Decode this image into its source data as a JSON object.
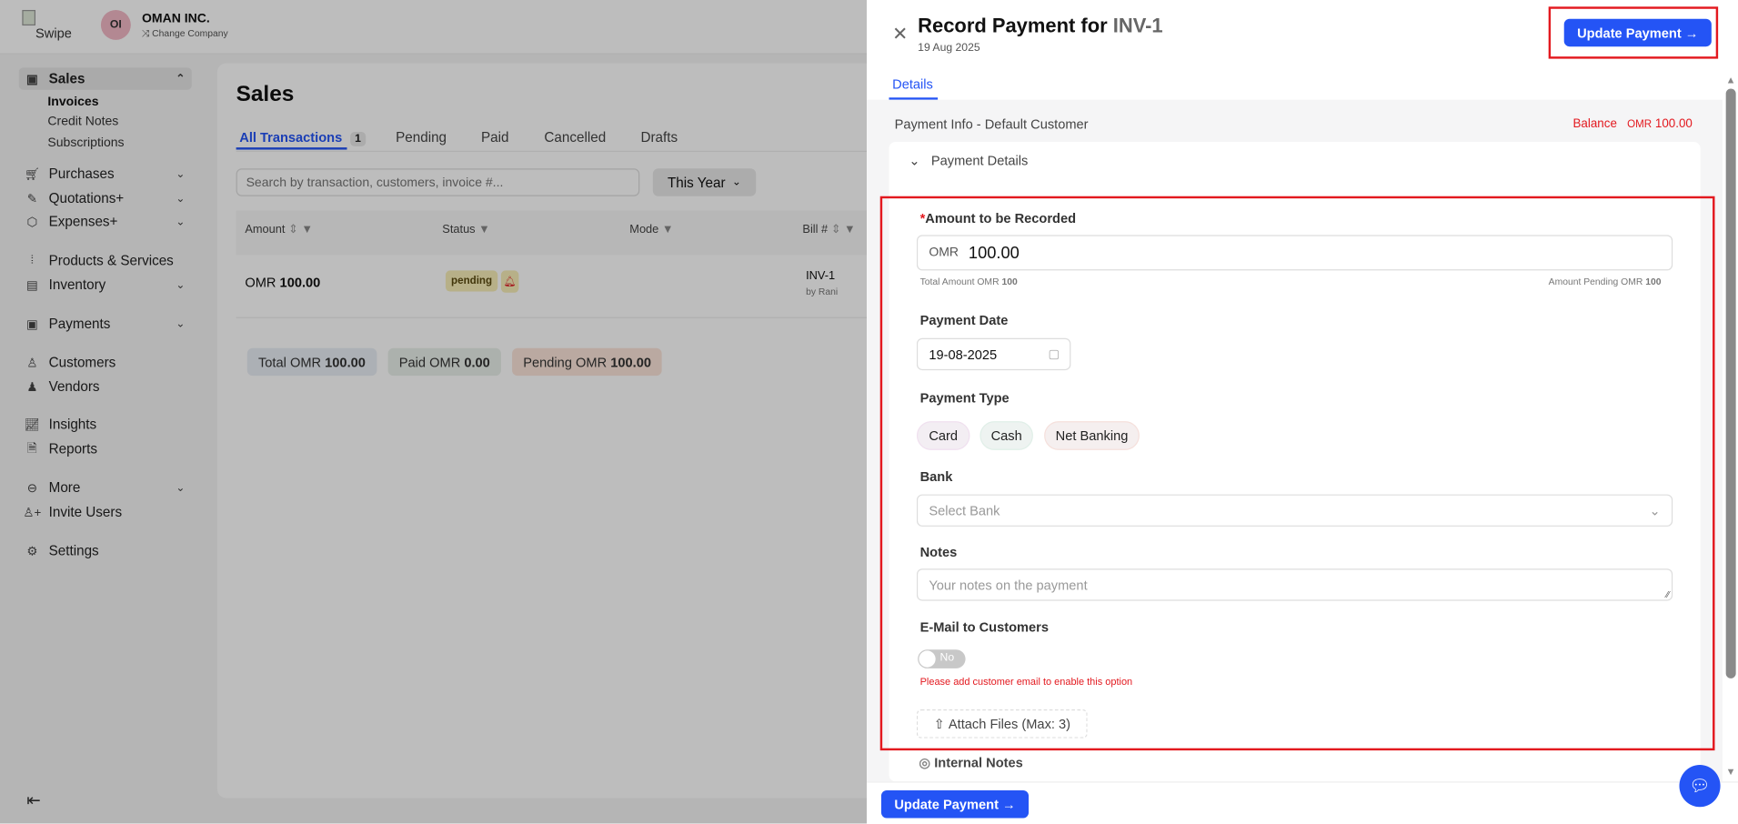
{
  "app": {
    "logo_alt": "Swipe",
    "company_initials": "OI",
    "company_name": "OMAN INC.",
    "change_company": "Change Company"
  },
  "sidebar": {
    "sales": "Sales",
    "sales_sub": [
      "Invoices",
      "Credit Notes",
      "Subscriptions"
    ],
    "items": [
      {
        "label": "Purchases"
      },
      {
        "label": "Quotations+"
      },
      {
        "label": "Expenses+"
      },
      {
        "label": "Products & Services"
      },
      {
        "label": "Inventory"
      },
      {
        "label": "Payments"
      },
      {
        "label": "Customers"
      },
      {
        "label": "Vendors"
      },
      {
        "label": "Insights"
      },
      {
        "label": "Reports"
      },
      {
        "label": "More"
      },
      {
        "label": "Invite Users"
      },
      {
        "label": "Settings"
      }
    ]
  },
  "sales": {
    "title": "Sales",
    "tabs": [
      "All Transactions",
      "Pending",
      "Paid",
      "Cancelled",
      "Drafts"
    ],
    "tab_count": "1",
    "search_placeholder": "Search by transaction, customers, invoice #...",
    "period": "This Year",
    "columns": [
      "Amount",
      "Status",
      "Mode",
      "Bill #"
    ],
    "row": {
      "currency": "OMR",
      "amount": "100.00",
      "status": "pending",
      "bill": "INV-1",
      "by": "by Rani"
    },
    "summary": {
      "total_label": "Total",
      "total_cur": "OMR",
      "total": "100.00",
      "paid_label": "Paid",
      "paid_cur": "OMR",
      "paid": "0.00",
      "pending_label": "Pending",
      "pending_cur": "OMR",
      "pending": "100.00"
    }
  },
  "drawer": {
    "title": "Record Payment for",
    "invoice": "INV-1",
    "date": "19 Aug 2025",
    "update_label": "Update Payment",
    "tab": "Details",
    "payment_info": "Payment Info - Default Customer",
    "balance_label": "Balance",
    "balance_cur": "OMR",
    "balance": "100.00",
    "section": "Payment Details",
    "amount_label": "Amount to be Recorded",
    "amount_cur": "OMR",
    "amount_value": "100.00",
    "total_hint": "Total Amount OMR",
    "total_hint_val": "100",
    "pending_hint": "Amount Pending OMR",
    "pending_hint_val": "100",
    "date_label": "Payment Date",
    "date_value": "19-08-2025",
    "type_label": "Payment Type",
    "types": [
      "Card",
      "Cash",
      "Net Banking"
    ],
    "bank_label": "Bank",
    "bank_placeholder": "Select Bank",
    "notes_label": "Notes",
    "notes_placeholder": "Your notes on the payment",
    "email_label": "E-Mail to Customers",
    "toggle": "No",
    "email_warning": "Please add customer email to enable this option",
    "attach": "Attach Files (Max: 3)",
    "internal_notes": "Internal Notes"
  }
}
